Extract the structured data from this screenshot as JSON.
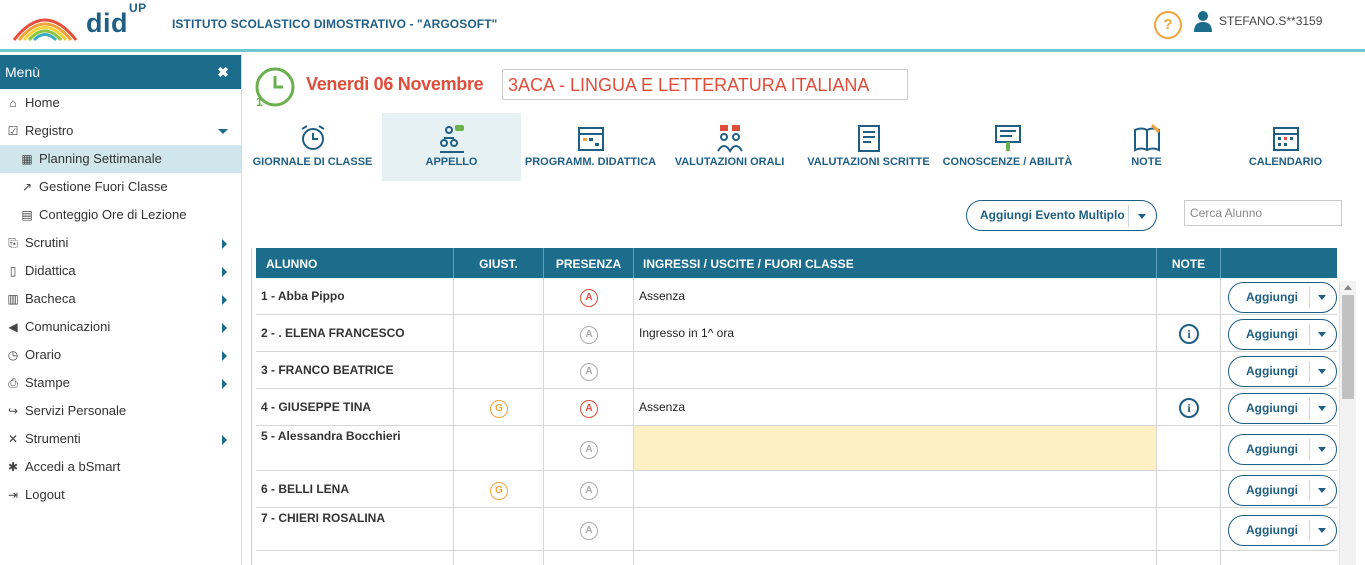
{
  "header": {
    "brand": "did",
    "brand_sup": "UP",
    "school": "ISTITUTO SCOLASTICO DIMOSTRATIVO - \"ARGOSOFT\"",
    "help": "?",
    "username": "STEFANO.S**3159"
  },
  "sidebar": {
    "title": "Menù",
    "close": "✖",
    "items": [
      {
        "label": "Home",
        "icon": "home-icon"
      },
      {
        "label": "Registro",
        "icon": "calendar-check-icon",
        "expanded": true
      },
      {
        "label": "Planning Settimanale",
        "icon": "calendar-icon",
        "sub": true,
        "active": true
      },
      {
        "label": "Gestione Fuori Classe",
        "icon": "external-link-icon",
        "sub": true
      },
      {
        "label": "Conteggio Ore di Lezione",
        "icon": "table-icon",
        "sub": true
      },
      {
        "label": "Scrutini",
        "icon": "file-export-icon",
        "has_children": true
      },
      {
        "label": "Didattica",
        "icon": "book-open-icon",
        "has_children": true
      },
      {
        "label": "Bacheca",
        "icon": "newspaper-icon",
        "has_children": true
      },
      {
        "label": "Comunicazioni",
        "icon": "megaphone-icon",
        "has_children": true
      },
      {
        "label": "Orario",
        "icon": "clock-icon",
        "has_children": true
      },
      {
        "label": "Stampe",
        "icon": "printer-icon",
        "has_children": true
      },
      {
        "label": "Servizi Personale",
        "icon": "share-icon"
      },
      {
        "label": "Strumenti",
        "icon": "tools-icon",
        "has_children": true
      },
      {
        "label": "Accedi a bSmart",
        "icon": "star-icon"
      },
      {
        "label": "Logout",
        "icon": "logout-icon"
      }
    ]
  },
  "main": {
    "date": "Venerdì 06 Novembre",
    "class_subject": "3ACA   - LINGUA E LETTERATURA ITALIANA",
    "tabs": [
      {
        "label": "GIORNALE DI CLASSE",
        "icon": "alarm-clock-icon"
      },
      {
        "label": "APPELLO",
        "icon": "attendance-icon",
        "active": true
      },
      {
        "label": "PROGRAMM. DIDATTICA",
        "icon": "planner-icon"
      },
      {
        "label": "VALUTAZIONI ORALI",
        "icon": "oral-grades-icon"
      },
      {
        "label": "VALUTAZIONI SCRITTE",
        "icon": "written-grades-icon"
      },
      {
        "label": "CONOSCENZE / ABILITÀ",
        "icon": "skills-icon"
      },
      {
        "label": "NOTE",
        "icon": "notes-icon"
      },
      {
        "label": "CALENDARIO",
        "icon": "calendar-grid-icon"
      }
    ],
    "add_multiple": "Aggiungi Evento Multiplo",
    "search_placeholder": "Cerca Alunno"
  },
  "table": {
    "headers": {
      "alunno": "ALUNNO",
      "giust": "GIUST.",
      "presenza": "PRESENZA",
      "ingressi": "INGRESSI / USCITE / FUORI CLASSE",
      "note": "NOTE"
    },
    "add_label": "Aggiungi",
    "rows": [
      {
        "name": "1 - Abba Pippo",
        "giust": "",
        "presenza": "A",
        "presenza_state": "absent",
        "ingressi": "Assenza",
        "note": false
      },
      {
        "name": "2 - . ELENA  FRANCESCO",
        "giust": "",
        "presenza": "A",
        "presenza_state": "present",
        "ingressi": "Ingresso in 1^ ora",
        "note": true
      },
      {
        "name": "3 - FRANCO  BEATRICE",
        "giust": "",
        "presenza": "A",
        "presenza_state": "present",
        "ingressi": "",
        "note": false
      },
      {
        "name": "4 - GIUSEPPE   TINA",
        "giust": "G",
        "presenza": "A",
        "presenza_state": "absent",
        "ingressi": "Assenza",
        "note": true
      },
      {
        "name": "5 - Alessandra Bocchieri",
        "giust": "",
        "presenza": "A",
        "presenza_state": "present",
        "ingressi": "",
        "note": false,
        "highlight": true
      },
      {
        "name": "6 - BELLI   LENA",
        "giust": "G",
        "presenza": "A",
        "presenza_state": "present",
        "ingressi": "",
        "note": false
      },
      {
        "name": "7 - CHIERI  ROSALINA",
        "giust": "",
        "presenza": "A",
        "presenza_state": "present",
        "ingressi": "",
        "note": false
      }
    ],
    "info_glyph": "i"
  },
  "colors": {
    "primary": "#1c6d8c",
    "accent_red": "#e04e3b",
    "accent_orange": "#f2a33a",
    "highlight": "#fdf0c4"
  }
}
